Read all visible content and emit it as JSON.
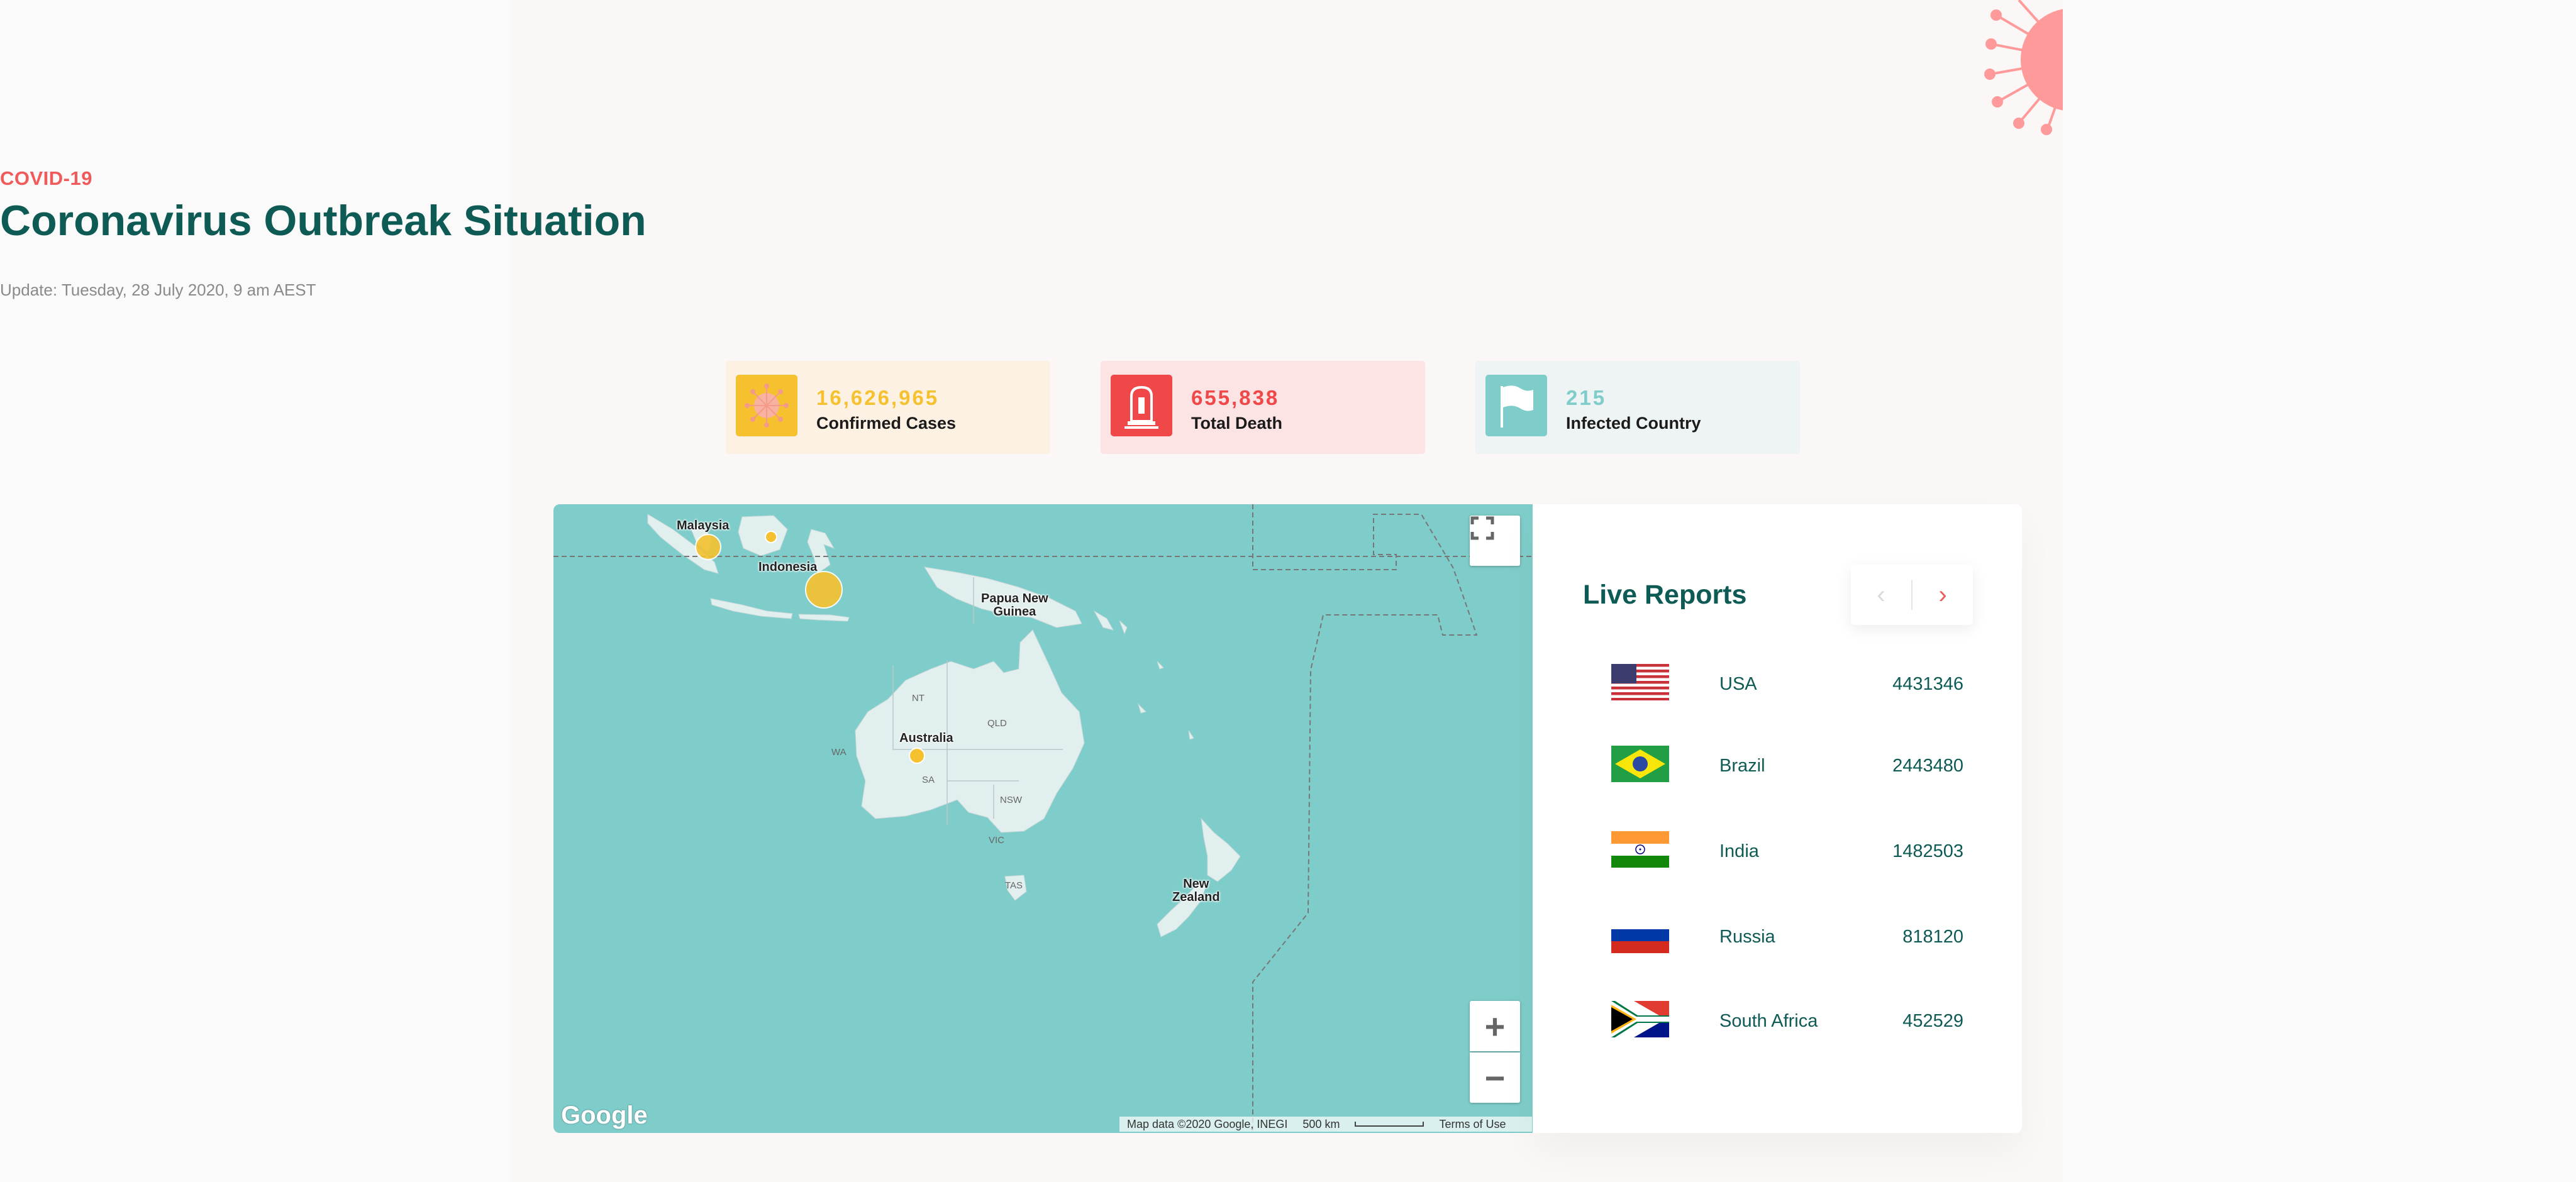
{
  "header": {
    "eyebrow": "COVID-19",
    "title": "Coronavirus Outbreak Situation",
    "update": "Update: Tuesday, 28 July 2020, 9 am AEST"
  },
  "stats": [
    {
      "value": "16,626,965",
      "label": "Confirmed Cases",
      "icon": "virus-icon",
      "color": "#f6c12f",
      "bg": "#fdf1e3"
    },
    {
      "value": "655,838",
      "label": "Total Death",
      "icon": "tombstone-icon",
      "color": "#f04848",
      "bg": "#fce4e4"
    },
    {
      "value": "215",
      "label": "Infected Country",
      "icon": "flag-icon",
      "color": "#7fcdca",
      "bg": "#eef3f3"
    }
  ],
  "map": {
    "labels": {
      "malaysia": "Malaysia",
      "indonesia": "Indonesia",
      "png": "Papua New\nGuinea",
      "australia": "Australia",
      "new_zealand": "New\nZealand"
    },
    "states": {
      "nt": "NT",
      "qld": "QLD",
      "wa": "WA",
      "sa": "SA",
      "nsw": "NSW",
      "vic": "VIC",
      "tas": "TAS"
    },
    "footer": {
      "data": "Map data ©2020 Google, INEGI",
      "scale": "500 km",
      "terms": "Terms of Use"
    },
    "logo": "Google",
    "zoom_in": "+",
    "zoom_out": "−"
  },
  "live_reports": {
    "title": "Live Reports",
    "pager_prev": "‹",
    "pager_next": "›",
    "rows": [
      {
        "country": "USA",
        "count": "4431346",
        "flag": "usa-flag-icon"
      },
      {
        "country": "Brazil",
        "count": "2443480",
        "flag": "brazil-flag-icon"
      },
      {
        "country": "India",
        "count": "1482503",
        "flag": "india-flag-icon"
      },
      {
        "country": "Russia",
        "count": "818120",
        "flag": "russia-flag-icon"
      },
      {
        "country": "South Africa",
        "count": "452529",
        "flag": "south-africa-flag-icon"
      }
    ]
  },
  "colors": {
    "primary": "#0e5a55",
    "accent": "#f05a5a",
    "sea": "#7fcdca",
    "land": "#e2efef"
  }
}
